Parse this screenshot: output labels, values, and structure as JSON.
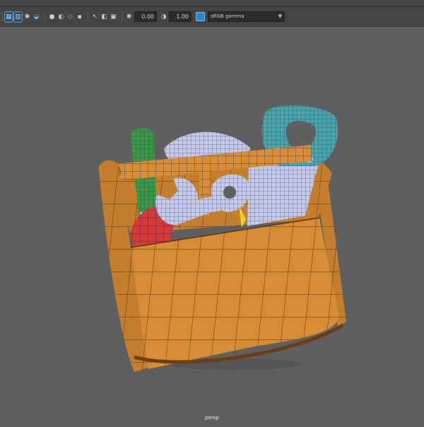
{
  "toolbar": {
    "icons": [
      "panel-grid-icon",
      "panel-select-icon",
      "light-icon",
      "display-icon",
      "shadow-icon",
      "sphere-icon",
      "lock-icon",
      "isolate-icon",
      "screen-icon",
      "x-ray-icon",
      "wireframe-on-shaded-icon",
      "exposure-icon"
    ],
    "exposure_value": "0.00",
    "gamma_value": "1.00",
    "color_management_label": "sRGB gamma"
  },
  "viewport": {
    "camera_label": "persp",
    "colors": {
      "background": "#5f5f5f",
      "wire": "#1c2c7a",
      "box_orange": "#d68d35",
      "handle_green": "#3c9a3f",
      "blade_teal": "#4aa5a6",
      "metal": "#c8cbe4",
      "red": "#d83a3a",
      "yellow": "#e9d230"
    }
  }
}
